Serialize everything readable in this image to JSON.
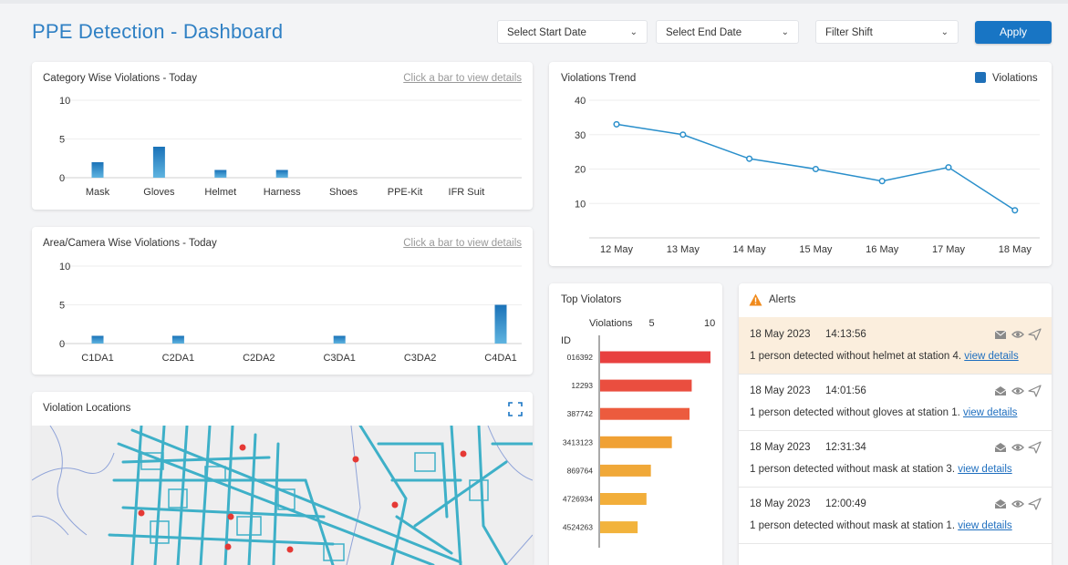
{
  "header": {
    "title": "PPE Detection - Dashboard",
    "start_date_placeholder": "Select Start Date",
    "end_date_placeholder": "Select End Date",
    "shift_placeholder": "Filter Shift",
    "apply_label": "Apply"
  },
  "category_card": {
    "title": "Category Wise Violations - Today",
    "link": "Click a bar to view details"
  },
  "area_card": {
    "title": "Area/Camera Wise Violations - Today",
    "link": "Click a bar to view details"
  },
  "trend_card": {
    "title": "Violations Trend"
  },
  "top_card": {
    "title": "Top Violators"
  },
  "map_card": {
    "title": "Violation Locations"
  },
  "alerts": {
    "title": "Alerts",
    "items": [
      {
        "date": "18 May 2023",
        "time": "14:13:56",
        "message": "1 person detected without helmet at station 4.",
        "link": "view details",
        "highlight": true
      },
      {
        "date": "18 May 2023",
        "time": "14:01:56",
        "message": "1 person detected without gloves at station 1.",
        "link": "view details",
        "highlight": false
      },
      {
        "date": "18 May 2023",
        "time": "12:31:34",
        "message": "1 person detected without mask at station 3.",
        "link": "view details",
        "highlight": false
      },
      {
        "date": "18 May 2023",
        "time": "12:00:49",
        "message": "1 person detected without mask at station 1.",
        "link": "view details",
        "highlight": false
      }
    ]
  },
  "colors": {
    "accent": "#1875c4",
    "bar_blue": "#1f7fc0",
    "line_blue": "#2a8fcb",
    "alert_highlight": "#fbeedd",
    "warning": "#f08a1c",
    "bar_red": "#e8403f",
    "bar_orange": "#f0a030"
  },
  "chart_data": [
    {
      "type": "bar",
      "title": "Category Wise Violations - Today",
      "categories": [
        "Mask",
        "Gloves",
        "Helmet",
        "Harness",
        "Shoes",
        "PPE-Kit",
        "IFR Suit"
      ],
      "values": [
        2,
        4,
        1,
        1,
        0,
        0,
        0
      ],
      "ylim": [
        0,
        10
      ],
      "yticks": [
        0,
        5,
        10
      ],
      "grid": true
    },
    {
      "type": "bar",
      "title": "Area/Camera Wise Violations - Today",
      "categories": [
        "C1DA1",
        "C2DA1",
        "C2DA2",
        "C3DA1",
        "C3DA2",
        "C4DA1"
      ],
      "values": [
        1,
        1,
        0,
        1,
        0,
        5
      ],
      "ylim": [
        0,
        10
      ],
      "yticks": [
        0,
        5,
        10
      ],
      "grid": true
    },
    {
      "type": "line",
      "title": "Violations Trend",
      "x": [
        "12 May",
        "13 May",
        "14 May",
        "15 May",
        "16 May",
        "17 May",
        "18 May"
      ],
      "series": [
        {
          "name": "Violations",
          "values": [
            33,
            30,
            23,
            20,
            16.5,
            20.5,
            8
          ]
        }
      ],
      "ylim": [
        0,
        40
      ],
      "yticks": [
        10,
        20,
        30,
        40
      ],
      "legend": "top-right",
      "grid": true
    },
    {
      "type": "bar",
      "orientation": "horizontal",
      "title": "Top Violators",
      "xlabel": "Violations",
      "ylabel": "ID",
      "categories": [
        "016392",
        "12293",
        "387742",
        "3413123",
        "869764",
        "4726934",
        "4524263"
      ],
      "values": [
        10,
        8.3,
        8.1,
        6.5,
        4.6,
        4.2,
        3.4
      ],
      "xlim": [
        0,
        10
      ],
      "xticks": [
        5,
        10
      ]
    }
  ]
}
